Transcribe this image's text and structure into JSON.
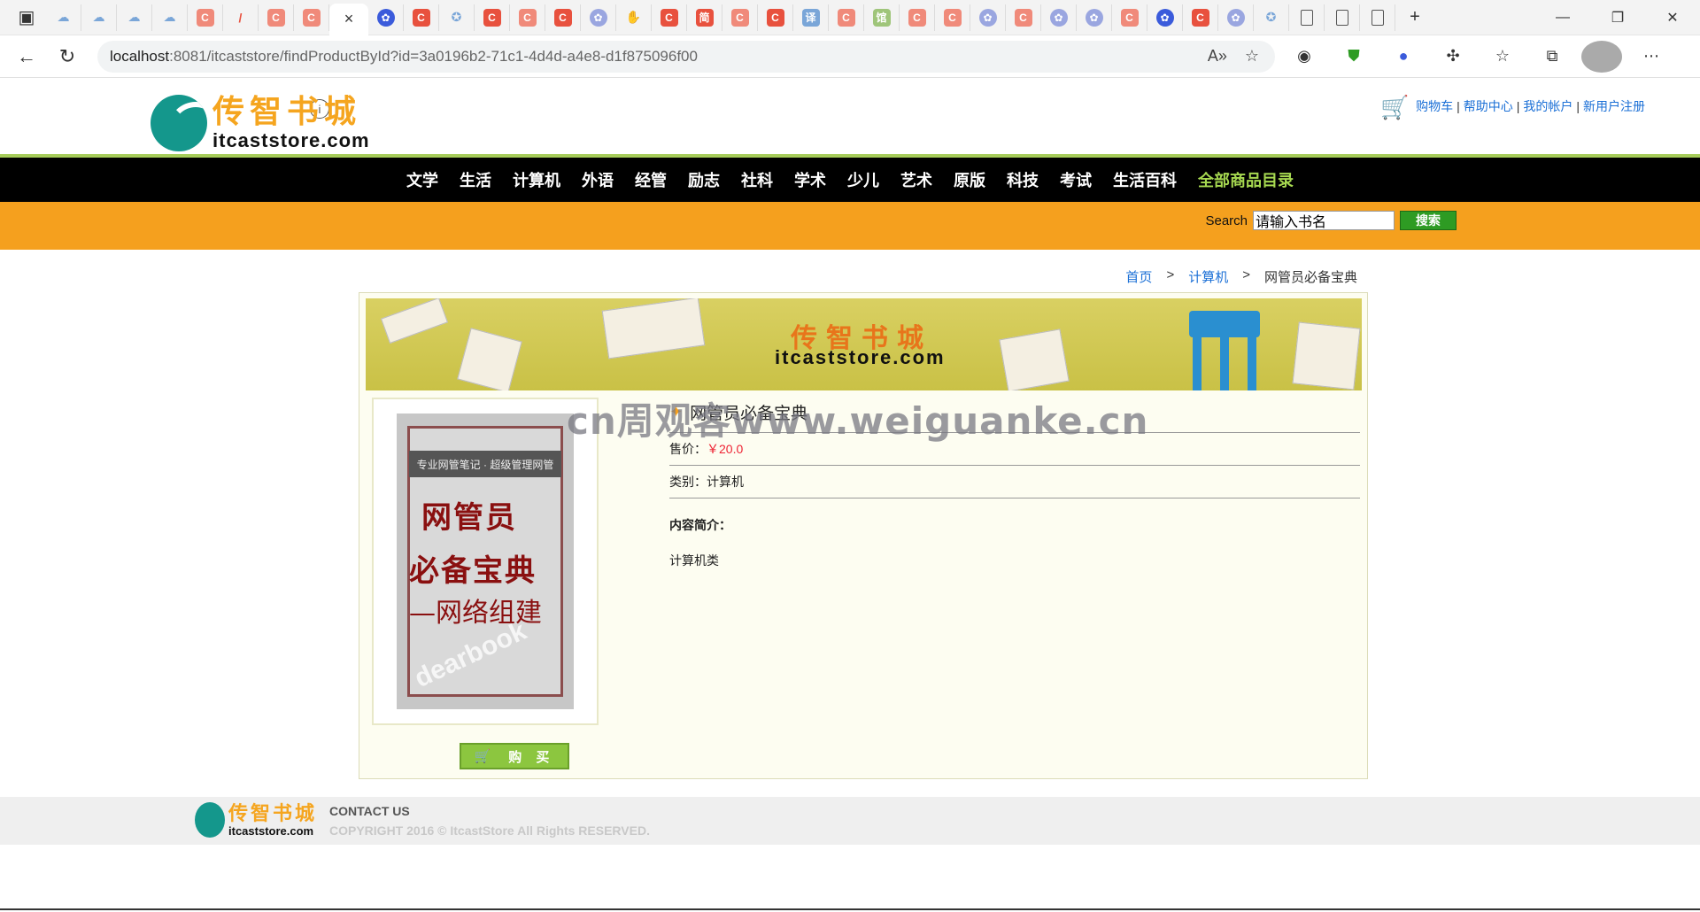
{
  "browser": {
    "url_host": "localhost",
    "url_path": ":8081/itcaststore/findProductById?id=3a0196b2-71c1-4d4d-a4e8-d1f875096f00",
    "tab_close_glyph": "×",
    "new_tab_glyph": "+",
    "tab_favicons": [
      "cloud",
      "cloud",
      "cloud",
      "cloud",
      "c",
      "pen",
      "c",
      "c",
      "active",
      "paw",
      "c",
      "globe",
      "c",
      "c",
      "c",
      "paw",
      "hand",
      "c",
      "简",
      "c",
      "c",
      "译",
      "c",
      "馆",
      "c",
      "c",
      "paw",
      "c",
      "paw",
      "paw",
      "c",
      "paw",
      "c",
      "paw",
      "globe",
      "doc",
      "doc",
      "doc"
    ]
  },
  "site": {
    "logo_cn": "传智书城",
    "logo_en": "itcaststore.com",
    "toplinks": [
      "购物车",
      "帮助中心",
      "我的帐户",
      "新用户注册"
    ],
    "categories": [
      "文学",
      "生活",
      "计算机",
      "外语",
      "经管",
      "励志",
      "社科",
      "学术",
      "少儿",
      "艺术",
      "原版",
      "科技",
      "考试",
      "生活百科"
    ],
    "all_categories": "全部商品目录",
    "search_label": "Search",
    "search_value": "请输入书名",
    "search_button": "搜索"
  },
  "breadcrumb": {
    "home": "首页",
    "sep": ">",
    "category": "计算机",
    "current": "网管员必备宝典"
  },
  "banner": {
    "cn": "传智书城",
    "en": "itcaststore.com"
  },
  "product": {
    "name": "网管员必备宝典",
    "price_label": "售价：",
    "price": "￥20.0",
    "category_label": "类别：",
    "category": "计算机",
    "intro_label": "内容简介：",
    "intro": "计算机类",
    "buy_button": "购 买",
    "cover": {
      "band_text": "专业网管笔记 · 超级管理网管",
      "line1": "网管员",
      "line2": "必备宝典",
      "line3": "—网络组建",
      "watermark": "dearbook"
    }
  },
  "watermark": "cn周观客www.weiguanke.cn",
  "footer": {
    "logo_cn": "传智书城",
    "logo_en": "itcaststore.com",
    "contact": "CONTACT US",
    "copyright": "COPYRIGHT 2016 © ItcastStore All Rights RESERVED."
  }
}
